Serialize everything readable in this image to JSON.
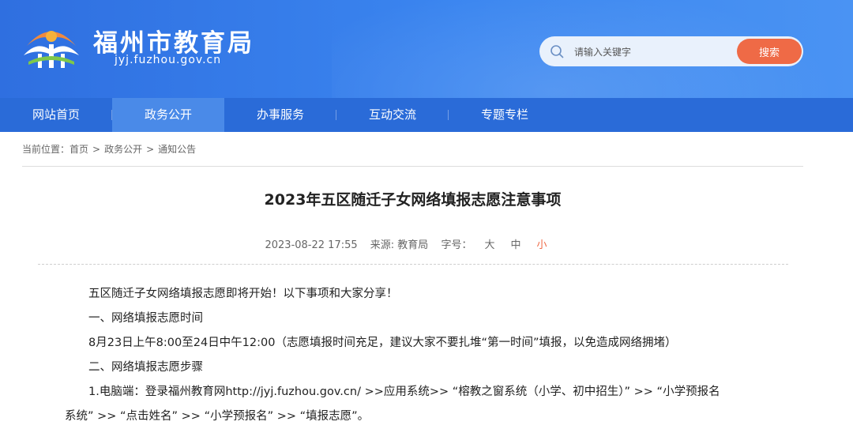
{
  "header": {
    "site_title": "福州市教育局",
    "site_domain": "jyj.fuzhou.gov.cn",
    "logo_icon": "fuzhou-education-logo-icon",
    "search": {
      "placeholder": "请输入关键字",
      "button_label": "搜索",
      "icon": "search-icon"
    }
  },
  "nav": {
    "items": [
      {
        "label": "网站首页"
      },
      {
        "label": "政务公开"
      },
      {
        "label": "办事服务"
      },
      {
        "label": "互动交流"
      },
      {
        "label": "专题专栏"
      }
    ],
    "active_index": 1
  },
  "breadcrumb": {
    "prefix": "当前位置：",
    "items": [
      "首页",
      "政务公开",
      "通知公告"
    ],
    "separator": ">"
  },
  "article": {
    "title": "2023年五区随迁子女网络填报志愿注意事项",
    "date": "2023-08-22 17:55",
    "source": "来源: 教育局",
    "font_size_label": "字号：",
    "font_sizes": [
      "大",
      "中",
      "小"
    ],
    "active_font_size": "小",
    "paragraphs": [
      "五区随迁子女网络填报志愿即将开始！以下事项和大家分享！",
      "一、网络填报志愿时间",
      "8月23日上午8:00至24日中午12:00（志愿填报时间充足，建议大家不要扎堆“第一时间”填报，以免造成网络拥堵）",
      "二、网络填报志愿步骤"
    ],
    "step1_part1": "1.电脑端：登录福州教育网http://jyj.fuzhou.gov.cn/ >>应用系统>> “榕教之窗系统（小学、初中招生）” >> “小学预报名",
    "step1_part2": "系统” >> “点击姓名” >> “小学预报名” >> “填报志愿”。"
  },
  "colors": {
    "header_blue": "#3b86f0",
    "nav_blue": "#2a6bd8",
    "nav_active": "#4a8ae8",
    "accent_orange": "#ef6a46"
  }
}
